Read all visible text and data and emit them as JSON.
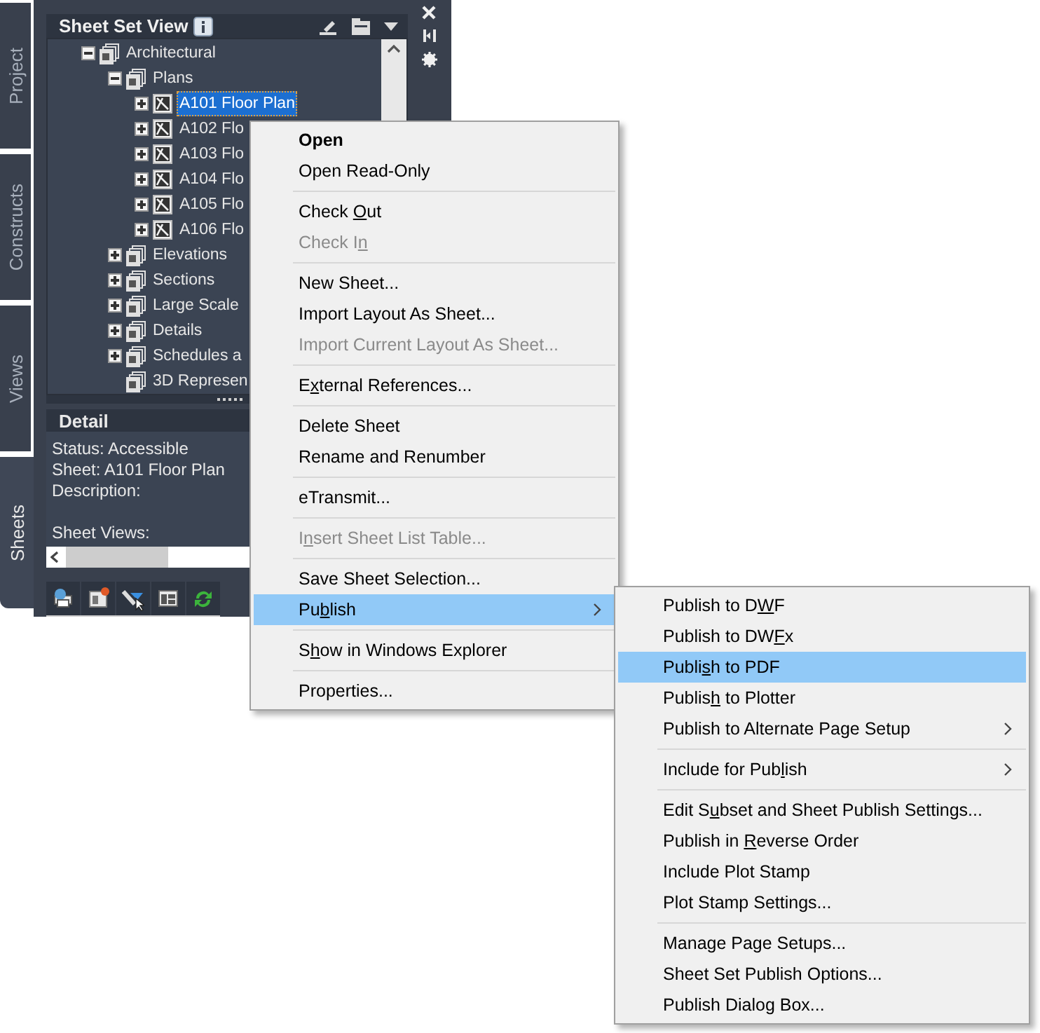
{
  "side_tabs": [
    {
      "label": "Project",
      "selected": false
    },
    {
      "label": "Constructs",
      "selected": false
    },
    {
      "label": "Views",
      "selected": false
    },
    {
      "label": "Sheets",
      "selected": true
    }
  ],
  "palette": {
    "title": "Sheet Set View"
  },
  "tree": [
    {
      "label": "Architectural",
      "kind": "subset",
      "expanded": true,
      "selected": false,
      "children": [
        {
          "label": "Plans",
          "kind": "subset",
          "expanded": true,
          "selected": false,
          "children": [
            {
              "label": "A101 Floor Plan",
              "kind": "sheet",
              "expanded": false,
              "selected": true
            },
            {
              "label": "A102 Flo",
              "kind": "sheet",
              "expanded": false,
              "selected": false
            },
            {
              "label": "A103 Flo",
              "kind": "sheet",
              "expanded": false,
              "selected": false
            },
            {
              "label": "A104 Flo",
              "kind": "sheet",
              "expanded": false,
              "selected": false
            },
            {
              "label": "A105 Flo",
              "kind": "sheet",
              "expanded": false,
              "selected": false
            },
            {
              "label": "A106 Flo",
              "kind": "sheet",
              "expanded": false,
              "selected": false
            }
          ]
        },
        {
          "label": "Elevations",
          "kind": "subset",
          "expanded": false,
          "selected": false
        },
        {
          "label": "Sections",
          "kind": "subset",
          "expanded": false,
          "selected": false
        },
        {
          "label": "Large Scale",
          "kind": "subset",
          "expanded": false,
          "selected": false
        },
        {
          "label": "Details",
          "kind": "subset",
          "expanded": false,
          "selected": false
        },
        {
          "label": "Schedules a",
          "kind": "subset",
          "expanded": false,
          "selected": false
        },
        {
          "label": "3D Represen",
          "kind": "leaf",
          "selected": false
        }
      ]
    }
  ],
  "detail": {
    "title": "Detail",
    "status": "Status: Accessible",
    "sheet": "Sheet: A101 Floor Plan",
    "description": "Description:",
    "sheet_views": "Sheet Views:"
  },
  "context_menu": [
    {
      "kind": "item",
      "pre": "Open",
      "default": true,
      "disabled": false,
      "selected": false
    },
    {
      "kind": "item",
      "pre": "Open Read-Only",
      "disabled": false,
      "selected": false
    },
    {
      "kind": "separator"
    },
    {
      "kind": "item",
      "pre": "Check ",
      "key": "O",
      "post": "ut",
      "disabled": false,
      "selected": false
    },
    {
      "kind": "item",
      "pre": "Check I",
      "key": "n",
      "disabled": true,
      "selected": false
    },
    {
      "kind": "separator"
    },
    {
      "kind": "item",
      "pre": "New Sheet...",
      "disabled": false,
      "selected": false
    },
    {
      "kind": "item",
      "pre": "Import Layout As Sheet...",
      "disabled": false,
      "selected": false
    },
    {
      "kind": "item",
      "pre": "Import Current Layout As Sheet...",
      "disabled": true,
      "selected": false
    },
    {
      "kind": "separator"
    },
    {
      "kind": "item",
      "pre": "E",
      "key": "x",
      "post": "ternal References...",
      "disabled": false,
      "selected": false
    },
    {
      "kind": "separator"
    },
    {
      "kind": "item",
      "pre": "Delete Sheet",
      "disabled": false,
      "selected": false
    },
    {
      "kind": "item",
      "pre": "Rename and Renumber",
      "disabled": false,
      "selected": false
    },
    {
      "kind": "separator"
    },
    {
      "kind": "item",
      "pre": "eTransmit...",
      "disabled": false,
      "selected": false
    },
    {
      "kind": "separator"
    },
    {
      "kind": "item",
      "pre": "I",
      "key": "n",
      "post": "sert Sheet List Table...",
      "disabled": true,
      "selected": false
    },
    {
      "kind": "separator"
    },
    {
      "kind": "item",
      "pre": "Save Sheet Selection...",
      "disabled": false,
      "selected": false
    },
    {
      "kind": "item",
      "pre": "Pu",
      "key": "b",
      "post": "lish",
      "disabled": false,
      "selected": true,
      "submenu": true
    },
    {
      "kind": "separator"
    },
    {
      "kind": "item",
      "pre": "S",
      "key": "h",
      "post": "ow in Windows Explorer",
      "disabled": false,
      "selected": false
    },
    {
      "kind": "separator"
    },
    {
      "kind": "item",
      "pre": "Properties...",
      "disabled": false,
      "selected": false
    }
  ],
  "publish_submenu": [
    {
      "kind": "item",
      "pre": "Publish to D",
      "key": "W",
      "post": "F",
      "disabled": false,
      "selected": false
    },
    {
      "kind": "item",
      "pre": "Publish to DW",
      "key": "F",
      "post": "x",
      "disabled": false,
      "selected": false
    },
    {
      "kind": "item",
      "pre": "Publi",
      "key": "s",
      "post": "h to PDF",
      "disabled": false,
      "selected": true
    },
    {
      "kind": "item",
      "pre": "Publis",
      "key": "h",
      "post": " to Plotter",
      "disabled": false,
      "selected": false
    },
    {
      "kind": "item",
      "pre": "Publish to Alternate Page Setup",
      "disabled": false,
      "selected": false,
      "submenu": true
    },
    {
      "kind": "separator"
    },
    {
      "kind": "item",
      "pre": "Include for Pub",
      "key": "l",
      "post": "ish",
      "disabled": false,
      "selected": false,
      "submenu": true
    },
    {
      "kind": "separator"
    },
    {
      "kind": "item",
      "pre": "Edit S",
      "key": "u",
      "post": "bset and Sheet Publish Settings...",
      "disabled": false,
      "selected": false
    },
    {
      "kind": "item",
      "pre": "Publish in ",
      "key": "R",
      "post": "everse Order",
      "disabled": false,
      "selected": false
    },
    {
      "kind": "item",
      "pre": "Include Plot Stamp",
      "disabled": false,
      "selected": false
    },
    {
      "kind": "item",
      "pre": "Plot Stamp Settings...",
      "disabled": false,
      "selected": false
    },
    {
      "kind": "separator"
    },
    {
      "kind": "item",
      "pre": "Manage Page Setups...",
      "disabled": false,
      "selected": false
    },
    {
      "kind": "item",
      "pre": "Sheet Set Publish Options...",
      "disabled": false,
      "selected": false
    },
    {
      "kind": "item",
      "pre": "Publish Dialog Box...",
      "disabled": false,
      "selected": false
    }
  ]
}
